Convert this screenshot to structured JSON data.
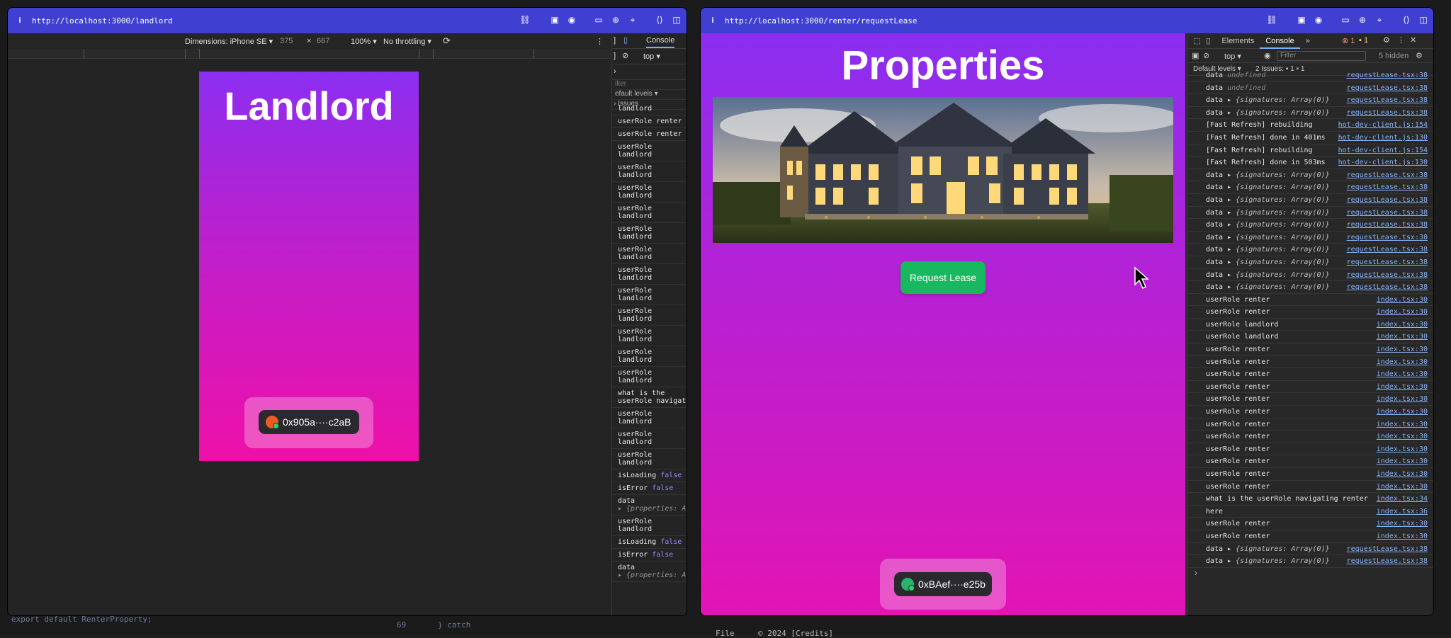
{
  "backdrop": {
    "code_bottom_left": "export default RenterProperty;",
    "gutter_69": "69",
    "code_69": "} catch",
    "footer_left": "File",
    "footer_middle": "© 2024 [Credits]"
  },
  "left_window": {
    "url": "http://localhost:3000/landlord",
    "device_toolbar": {
      "dimensions": "Dimensions: iPhone SE",
      "width": "375",
      "times": "×",
      "height": "667",
      "zoom": "100%",
      "throttling": "No throttling"
    },
    "page_title": "Landlord",
    "wallet_address": "0x905a····c2aB",
    "console": {
      "tab": "Console",
      "context": "top",
      "filter_placeholder": "ilter",
      "levels": "efault levels",
      "issues": "Issues",
      "entries": [
        {
          "a": "landlord",
          "b": ""
        },
        {
          "a": "userRole renter",
          "b": ""
        },
        {
          "a": "userRole renter",
          "b": ""
        },
        {
          "a": "userRole",
          "b": "landlord"
        },
        {
          "a": "userRole",
          "b": "landlord"
        },
        {
          "a": "userRole",
          "b": "landlord"
        },
        {
          "a": "userRole",
          "b": "landlord"
        },
        {
          "a": "userRole",
          "b": "landlord"
        },
        {
          "a": "userRole",
          "b": "landlord"
        },
        {
          "a": "userRole",
          "b": "landlord"
        },
        {
          "a": "userRole",
          "b": "landlord"
        },
        {
          "a": "userRole",
          "b": "landlord"
        },
        {
          "a": "userRole",
          "b": "landlord"
        },
        {
          "a": "userRole",
          "b": "landlord"
        },
        {
          "a": "userRole",
          "b": "landlord"
        },
        {
          "a": "what is the",
          "b": "userRole navigati"
        },
        {
          "a": "userRole",
          "b": "landlord"
        },
        {
          "a": "userRole",
          "b": "landlord"
        },
        {
          "a": "userRole",
          "b": "landlord"
        }
      ],
      "tail": {
        "is_loading_1": "isLoading",
        "is_error_1": "isError",
        "false": "false",
        "data_label": "data",
        "properties_preview": "▸ {properties: A",
        "user_role": "userRole",
        "landlord": "landlord",
        "is_loading_2": "isLoading",
        "is_error_2": "isError"
      }
    }
  },
  "right_window": {
    "url": "http://localhost:3000/renter/requestLease",
    "page_title": "Properties",
    "request_button": "Request Lease",
    "wallet_address": "0xBAef····e25b",
    "devtools": {
      "tabs": [
        "Elements",
        "Console"
      ],
      "more_tabs": "»",
      "errors": "1",
      "warnings": "1",
      "context": "top",
      "filter_placeholder": "Filter",
      "hidden": "5 hidden",
      "levels": "Default levels",
      "issues_label": "2 Issues:",
      "issue_warn": "1",
      "issue_info": "1",
      "prompt": "›",
      "entries": [
        {
          "text": "data",
          "extra": "undefined",
          "kind": "und",
          "src": "requestLease.tsx:38"
        },
        {
          "text": "data",
          "extra": "undefined",
          "kind": "und",
          "src": "requestLease.tsx:38"
        },
        {
          "text": "data ▸",
          "extra": "{signatures: Array(0)}",
          "kind": "obj",
          "src": "requestLease.tsx:38"
        },
        {
          "text": "data ▸",
          "extra": "{signatures: Array(0)}",
          "kind": "obj",
          "src": "requestLease.tsx:38"
        },
        {
          "text": "[Fast Refresh] rebuilding",
          "extra": "",
          "kind": "",
          "src": "hot-dev-client.js:154"
        },
        {
          "text": "[Fast Refresh] done in 401ms",
          "extra": "",
          "kind": "",
          "src": "hot-dev-client.js:130"
        },
        {
          "text": "[Fast Refresh] rebuilding",
          "extra": "",
          "kind": "",
          "src": "hot-dev-client.js:154"
        },
        {
          "text": "[Fast Refresh] done in 503ms",
          "extra": "",
          "kind": "",
          "src": "hot-dev-client.js:130"
        },
        {
          "text": "data ▸",
          "extra": "{signatures: Array(0)}",
          "kind": "obj",
          "src": "requestLease.tsx:38"
        },
        {
          "text": "data ▸",
          "extra": "{signatures: Array(0)}",
          "kind": "obj",
          "src": "requestLease.tsx:38"
        },
        {
          "text": "data ▸",
          "extra": "{signatures: Array(0)}",
          "kind": "obj",
          "src": "requestLease.tsx:38"
        },
        {
          "text": "data ▸",
          "extra": "{signatures: Array(0)}",
          "kind": "obj",
          "src": "requestLease.tsx:38"
        },
        {
          "text": "data ▸",
          "extra": "{signatures: Array(0)}",
          "kind": "obj",
          "src": "requestLease.tsx:38"
        },
        {
          "text": "data ▸",
          "extra": "{signatures: Array(0)}",
          "kind": "obj",
          "src": "requestLease.tsx:38"
        },
        {
          "text": "data ▸",
          "extra": "{signatures: Array(0)}",
          "kind": "obj",
          "src": "requestLease.tsx:38"
        },
        {
          "text": "data ▸",
          "extra": "{signatures: Array(0)}",
          "kind": "obj",
          "src": "requestLease.tsx:38"
        },
        {
          "text": "data ▸",
          "extra": "{signatures: Array(0)}",
          "kind": "obj",
          "src": "requestLease.tsx:38"
        },
        {
          "text": "data ▸",
          "extra": "{signatures: Array(0)}",
          "kind": "obj",
          "src": "requestLease.tsx:38"
        },
        {
          "text": "userRole renter",
          "extra": "",
          "kind": "",
          "src": "index.tsx:30"
        },
        {
          "text": "userRole renter",
          "extra": "",
          "kind": "",
          "src": "index.tsx:30"
        },
        {
          "text": "userRole landlord",
          "extra": "",
          "kind": "",
          "src": "index.tsx:30"
        },
        {
          "text": "userRole landlord",
          "extra": "",
          "kind": "",
          "src": "index.tsx:30"
        },
        {
          "text": "userRole renter",
          "extra": "",
          "kind": "",
          "src": "index.tsx:30"
        },
        {
          "text": "userRole renter",
          "extra": "",
          "kind": "",
          "src": "index.tsx:30"
        },
        {
          "text": "userRole renter",
          "extra": "",
          "kind": "",
          "src": "index.tsx:30"
        },
        {
          "text": "userRole renter",
          "extra": "",
          "kind": "",
          "src": "index.tsx:30"
        },
        {
          "text": "userRole renter",
          "extra": "",
          "kind": "",
          "src": "index.tsx:30"
        },
        {
          "text": "userRole renter",
          "extra": "",
          "kind": "",
          "src": "index.tsx:30"
        },
        {
          "text": "userRole renter",
          "extra": "",
          "kind": "",
          "src": "index.tsx:30"
        },
        {
          "text": "userRole renter",
          "extra": "",
          "kind": "",
          "src": "index.tsx:30"
        },
        {
          "text": "userRole renter",
          "extra": "",
          "kind": "",
          "src": "index.tsx:30"
        },
        {
          "text": "userRole renter",
          "extra": "",
          "kind": "",
          "src": "index.tsx:30"
        },
        {
          "text": "userRole renter",
          "extra": "",
          "kind": "",
          "src": "index.tsx:30"
        },
        {
          "text": "userRole renter",
          "extra": "",
          "kind": "",
          "src": "index.tsx:30"
        },
        {
          "text": "what is the userRole navigating renter",
          "extra": "",
          "kind": "",
          "src": "index.tsx:34"
        },
        {
          "text": "here",
          "extra": "",
          "kind": "",
          "src": "index.tsx:36"
        },
        {
          "text": "userRole renter",
          "extra": "",
          "kind": "",
          "src": "index.tsx:30"
        },
        {
          "text": "userRole renter",
          "extra": "",
          "kind": "",
          "src": "index.tsx:30"
        },
        {
          "text": "data ▸",
          "extra": "{signatures: Array(0)}",
          "kind": "obj",
          "src": "requestLease.tsx:38"
        },
        {
          "text": "data ▸",
          "extra": "{signatures: Array(0)}",
          "kind": "obj",
          "src": "requestLease.tsx:38"
        }
      ]
    }
  },
  "colors": {
    "url_bar": "#3f3fd2",
    "gradient_top": "#8c2ef0",
    "gradient_bottom": "#ee10a8",
    "button_green": "#17b85f",
    "link_blue": "#8ab4f8"
  }
}
